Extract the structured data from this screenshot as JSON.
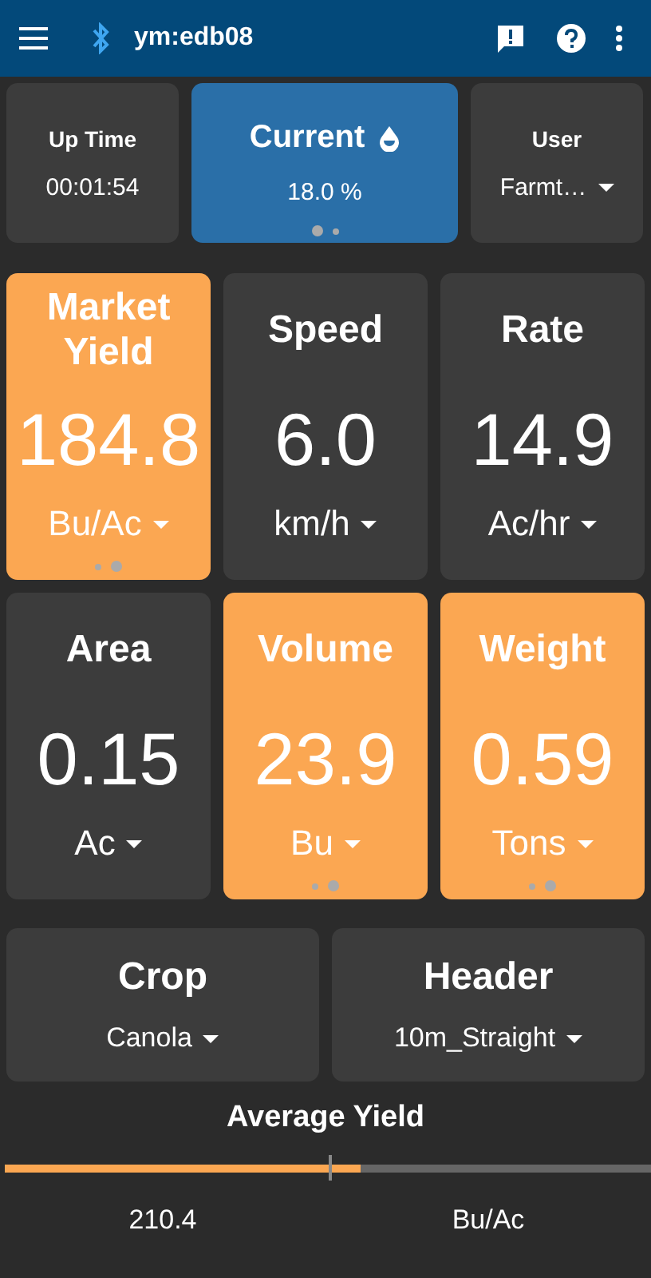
{
  "app_bar": {
    "title": "ym:edb08"
  },
  "summary": [
    {
      "kind": "plain",
      "label": "Up Time",
      "value": "00:01:54"
    },
    {
      "kind": "moisture",
      "label": "Current",
      "value": "18.0 %",
      "dots": [
        {
          "selected": true
        },
        {
          "selected": false
        }
      ]
    },
    {
      "kind": "dropdown",
      "label": "User",
      "value": "Farmt…"
    }
  ],
  "tiles": [
    {
      "label": "Market Yield",
      "value": "184.8",
      "unit": "Bu/Ac",
      "highlighted": true,
      "dots": [
        {
          "selected": false
        },
        {
          "selected": true
        }
      ]
    },
    {
      "label": "Speed",
      "value": "6.0",
      "unit": "km/h",
      "highlighted": false
    },
    {
      "label": "Rate",
      "value": "14.9",
      "unit": "Ac/hr",
      "highlighted": false
    },
    {
      "label": "Area",
      "value": "0.15",
      "unit": "Ac",
      "highlighted": false
    },
    {
      "label": "Volume",
      "value": "23.9",
      "unit": "Bu",
      "highlighted": true,
      "dots": [
        {
          "selected": false
        },
        {
          "selected": true
        }
      ]
    },
    {
      "label": "Weight",
      "value": "0.59",
      "unit": "Tons",
      "highlighted": true,
      "dots": [
        {
          "selected": false
        },
        {
          "selected": true
        }
      ]
    }
  ],
  "selectors": [
    {
      "label": "Crop",
      "value": "Canola"
    },
    {
      "label": "Header",
      "value": "10m_Straight"
    }
  ],
  "average": {
    "title": "Average Yield",
    "level": 0.55,
    "value": "210.4",
    "unit": "Bu/Ac"
  }
}
